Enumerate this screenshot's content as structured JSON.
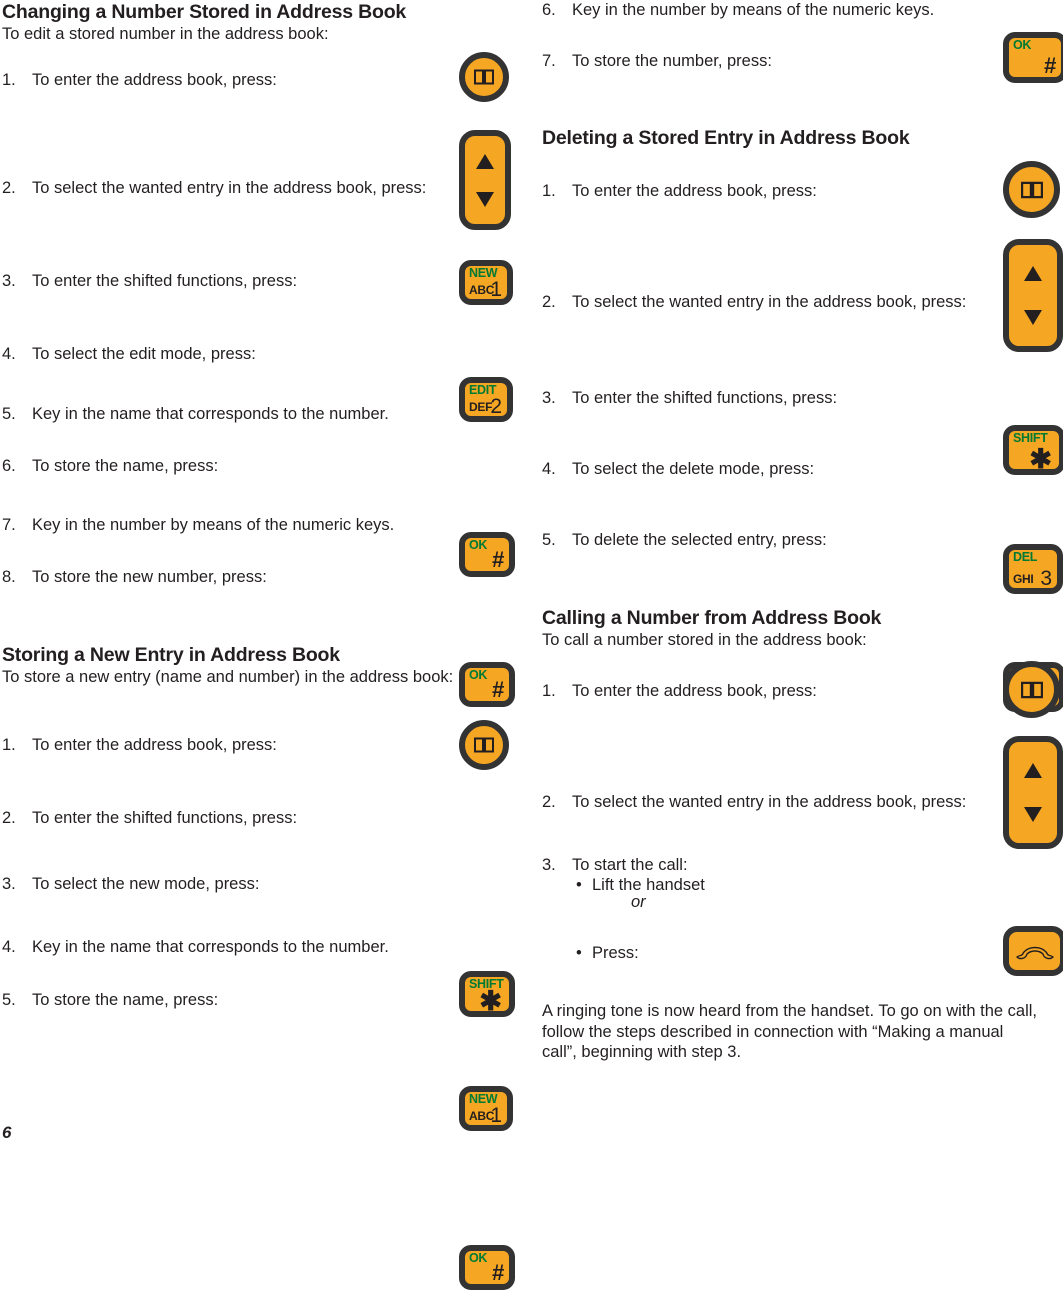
{
  "page": {
    "number": "6"
  },
  "left_column": {
    "section1": {
      "title": "Changing a Number Stored in Address Book",
      "intro": "To edit a stored number in the address book:",
      "steps": [
        {
          "num": "1.",
          "text": "To enter the address book, press:",
          "icon": "address-book-key"
        },
        {
          "num": "2.",
          "text": "To select the wanted entry in the address book, press:",
          "icon": "up-down-arrow-key"
        },
        {
          "num": "3.",
          "text": "To enter the shifted functions, press:",
          "icon": "new-abc-1-key"
        },
        {
          "num": "4.",
          "text": "To select the edit mode, press:",
          "icon": "edit-def-2-key"
        },
        {
          "num": "5.",
          "text": "Key in the name that corresponds to the number.",
          "icon": ""
        },
        {
          "num": "6.",
          "text": "To store the name, press:",
          "icon": "ok-hash-key"
        },
        {
          "num": "7.",
          "text": "Key in the number by means of the numeric keys.",
          "icon": ""
        },
        {
          "num": "8.",
          "text": "To store the new number, press:",
          "icon": "ok-hash-key"
        }
      ]
    },
    "section2": {
      "title": "Storing a New Entry in Address Book",
      "intro": "To store a new entry (name and number) in the address book:",
      "steps": [
        {
          "num": "1.",
          "text": "To enter the address book, press:",
          "icon": "address-book-key"
        },
        {
          "num": "2.",
          "text": "To enter the shifted functions, press:",
          "icon": "shift-star-key"
        },
        {
          "num": "3.",
          "text": "To select the new mode, press:",
          "icon": "new-abc-1-key"
        },
        {
          "num": "4.",
          "text": "Key in the name that corresponds to the number.",
          "icon": ""
        },
        {
          "num": "5.",
          "text": "To store the name, press:",
          "icon": "ok-hash-key"
        }
      ]
    }
  },
  "right_column": {
    "continued_steps": [
      {
        "num": "6.",
        "text": "Key in the number by means of the numeric keys.",
        "icon": ""
      },
      {
        "num": "7.",
        "text": "To store the number, press:",
        "icon": "ok-hash-key"
      }
    ],
    "section3": {
      "title": "Deleting a Stored Entry in Address Book",
      "steps": [
        {
          "num": "1.",
          "text": "To enter the address book, press:",
          "icon": "address-book-key"
        },
        {
          "num": "2.",
          "text": "To select the wanted entry in the address book, press:",
          "icon": "up-down-arrow-key"
        },
        {
          "num": "3.",
          "text": "To enter the shifted functions, press:",
          "icon": "shift-star-key"
        },
        {
          "num": "4.",
          "text": "To select the delete mode, press:",
          "icon": "del-ghi-3-key"
        },
        {
          "num": "5.",
          "text": "To delete the selected entry, press:",
          "icon": "ok-hash-key"
        }
      ]
    },
    "section4": {
      "title": "Calling a Number from Address Book",
      "intro": "To call a number stored in the address book:",
      "steps": [
        {
          "num": "1.",
          "text": "To enter the address book, press:",
          "icon": "address-book-key"
        },
        {
          "num": "2.",
          "text": "To select the wanted entry in the address book, press:",
          "icon": "up-down-arrow-key"
        },
        {
          "num": "3.",
          "text": "To start the call:",
          "icon": ""
        }
      ],
      "bullet1": "Lift the handset",
      "or": "or",
      "bullet2": "Press:",
      "bullet_glyph": "•",
      "closing_paragraph": "A ringing tone is now heard from the handset. To go on with the call, follow the steps described in connection with “Making a manual call”, beginning with step 3."
    }
  },
  "key_labels": {
    "new": "NEW",
    "abc": "ABC",
    "one": "1",
    "edit": "EDIT",
    "def": "DEF",
    "two": "2",
    "del": "DEL",
    "ghi": "GHI",
    "three": "3",
    "ok": "OK",
    "hash": "#",
    "shift": "SHIFT",
    "star": "✱"
  },
  "colors": {
    "key_orange": "#F5A623",
    "key_border": "#333333",
    "label_green": "#007a33",
    "text_black": "#231f20"
  }
}
